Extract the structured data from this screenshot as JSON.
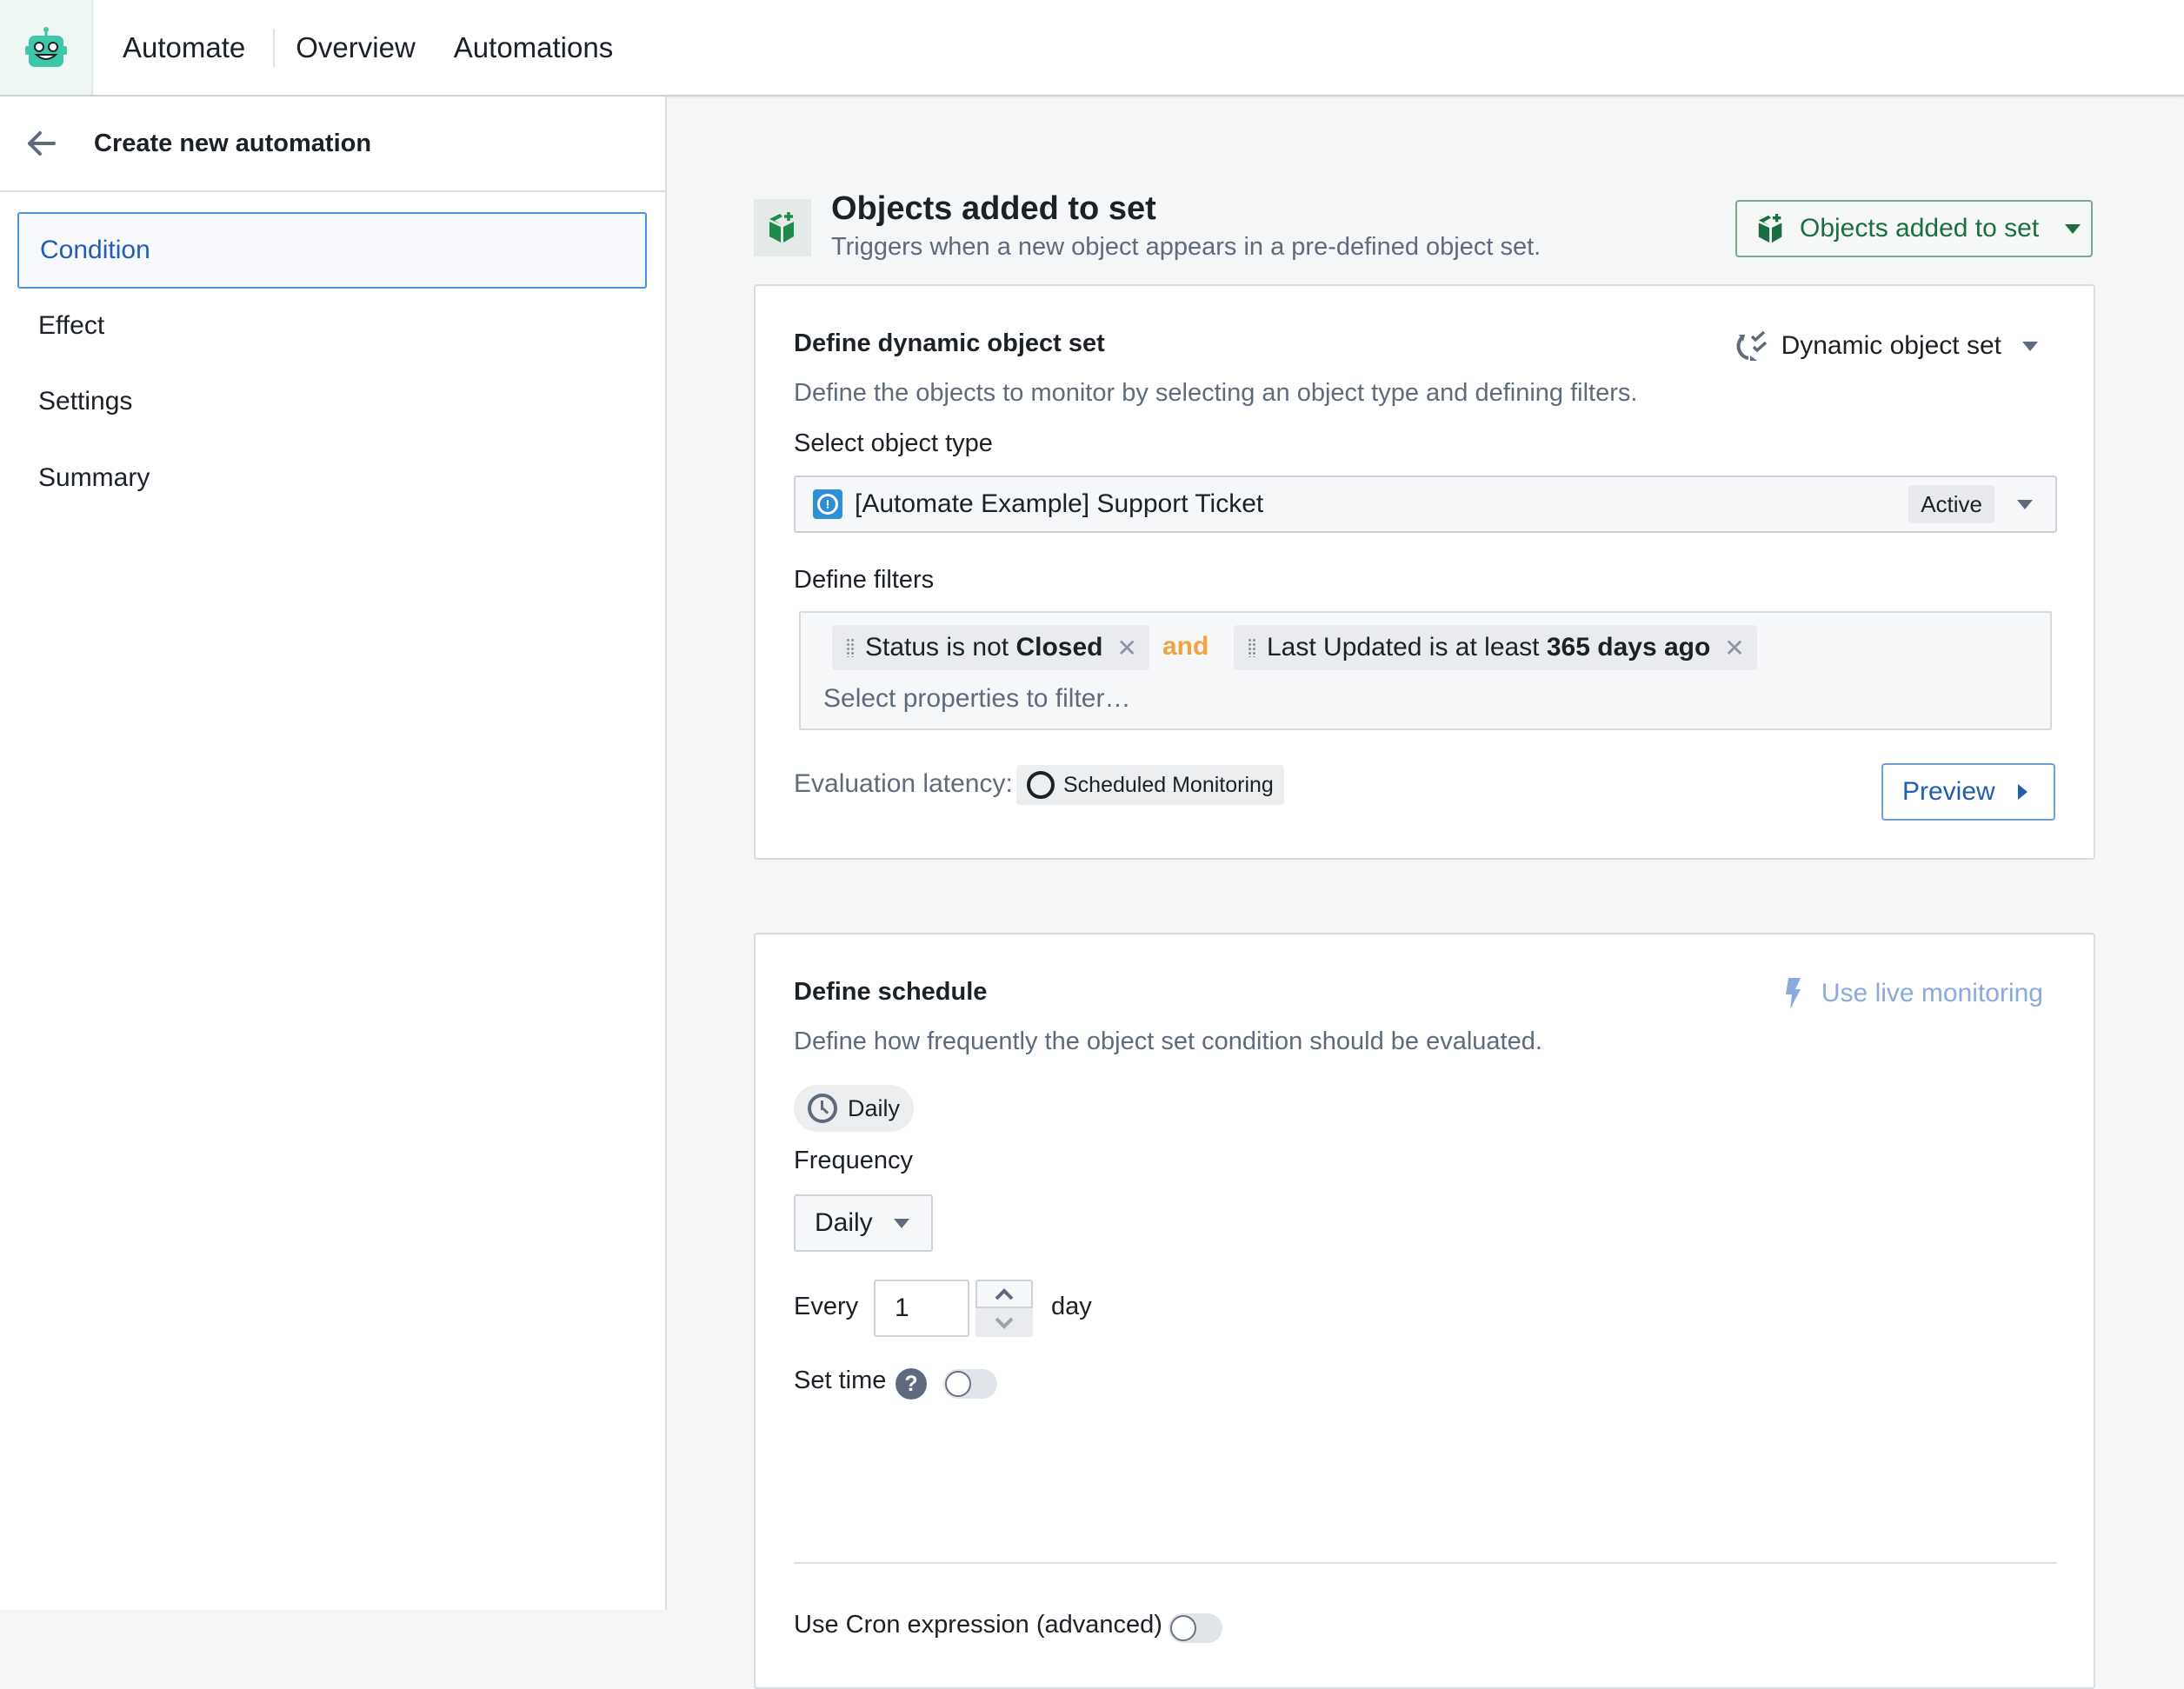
{
  "topbar": {
    "logo_icon": "robot-icon",
    "app_name": "Automate",
    "links": [
      "Overview",
      "Automations"
    ]
  },
  "sidebar": {
    "back_icon": "arrow-left-icon",
    "title": "Create new automation",
    "items": [
      {
        "label": "Condition",
        "active": true
      },
      {
        "label": "Effect",
        "active": false
      },
      {
        "label": "Settings",
        "active": false
      },
      {
        "label": "Summary",
        "active": false
      }
    ]
  },
  "header": {
    "icon": "cube-add-icon",
    "title": "Objects added to set",
    "subtitle": "Triggers when a new object appears in a pre-defined object set.",
    "trigger_select": "Objects added to set"
  },
  "object_set_card": {
    "title": "Define dynamic object set",
    "mode_select": "Dynamic object set",
    "description": "Define the objects to monitor by selecting an object type and defining filters.",
    "object_type_label": "Select object type",
    "object_type_value": "[Automate Example] Support Ticket",
    "object_type_status": "Active",
    "filters_label": "Define filters",
    "filters": [
      {
        "prefix": "Status is not ",
        "value": "Closed"
      },
      {
        "prefix": "Last Updated is at least ",
        "value": "365 days ago"
      }
    ],
    "filter_conjunction": "and",
    "filter_placeholder": "Select properties to filter…",
    "latency_label": "Evaluation latency:",
    "latency_value": "Scheduled Monitoring",
    "preview_button": "Preview"
  },
  "schedule_card": {
    "title": "Define schedule",
    "live_monitoring_link": "Use live monitoring",
    "description": "Define how frequently the object set condition should be evaluated.",
    "schedule_pill": "Daily",
    "frequency_label": "Frequency",
    "frequency_value": "Daily",
    "every_label": "Every",
    "every_value": "1",
    "every_unit": "day",
    "set_time_label": "Set time",
    "set_time_enabled": false,
    "cron_label": "Use Cron expression (advanced)",
    "cron_enabled": false
  },
  "colors": {
    "accent_blue": "#215db0",
    "trigger_green": "#1c6e42",
    "and_orange": "#f0a33e",
    "logo_teal": "#3cc8a8"
  }
}
